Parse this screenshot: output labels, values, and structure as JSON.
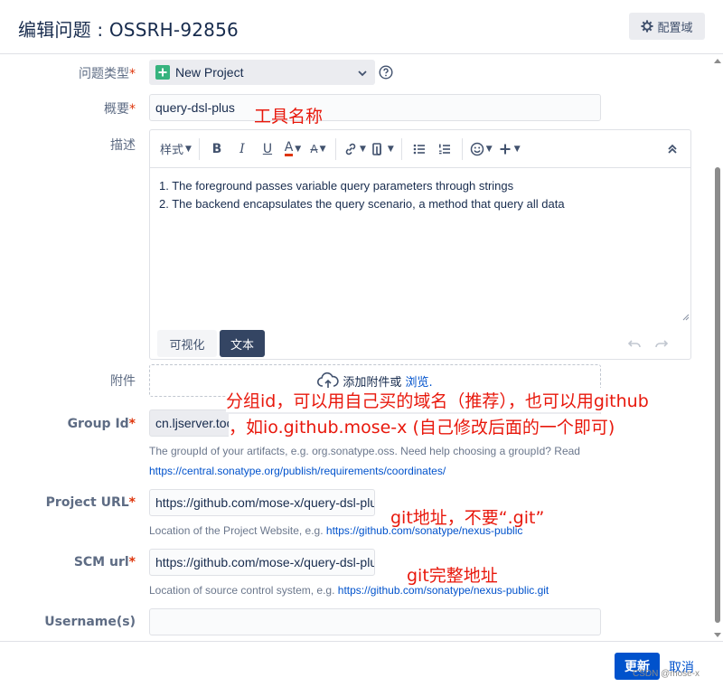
{
  "header": {
    "title": "编辑问题 : OSSRH-92856",
    "config_button": "配置域"
  },
  "form": {
    "issue_type": {
      "label": "问题类型",
      "required": "*",
      "value": "New Project"
    },
    "summary": {
      "label": "概要",
      "required": "*",
      "value": "query-dsl-plus"
    },
    "description": {
      "label": "描述",
      "toolbar": {
        "style_label": "样式",
        "bold": "B",
        "italic": "I",
        "underline": "U",
        "color": "A",
        "more_text": "A"
      },
      "lines": [
        "1. The foreground passes variable query parameters through strings",
        "2. The backend encapsulates the query scenario, a method that query all data"
      ],
      "visual_tab": "可视化",
      "text_tab": "文本"
    },
    "attachment": {
      "label": "附件",
      "text": "添加附件或",
      "link": "浏览."
    },
    "group_id": {
      "label": "Group Id",
      "required": "*",
      "value": "cn.ljserver.tool",
      "help": "The groupId of your artifacts, e.g. org.sonatype.oss. Need help choosing a groupId? Read",
      "help_link": "https://central.sonatype.org/publish/requirements/coordinates/"
    },
    "project_url": {
      "label": "Project URL",
      "required": "*",
      "value": "https://github.com/mose-x/query-dsl-plus",
      "help": "Location of the Project Website, e.g.",
      "help_link": "https://github.com/sonatype/nexus-public"
    },
    "scm_url": {
      "label": "SCM url",
      "required": "*",
      "value": "https://github.com/mose-x/query-dsl-plus.git",
      "help": "Location of source control system, e.g.",
      "help_link": "https://github.com/sonatype/nexus-public.git"
    },
    "username": {
      "label": "Username(s)",
      "value": ""
    }
  },
  "annotations": {
    "summary_note": "工具名称",
    "group_note_1": "分组id，可以用自己买的域名（推荐），也可以用github",
    "group_note_2": "，如io.github.mose-x (自己修改后面的一个即可)",
    "project_note": "git地址，不要“.git”",
    "scm_note": "git完整地址"
  },
  "footer": {
    "update": "更新",
    "cancel": "取消",
    "watermark": "CSDN @mose-x"
  },
  "colors": {
    "accent": "#0052cc",
    "annotation": "#e8180c",
    "add_icon": "#36b37e"
  }
}
